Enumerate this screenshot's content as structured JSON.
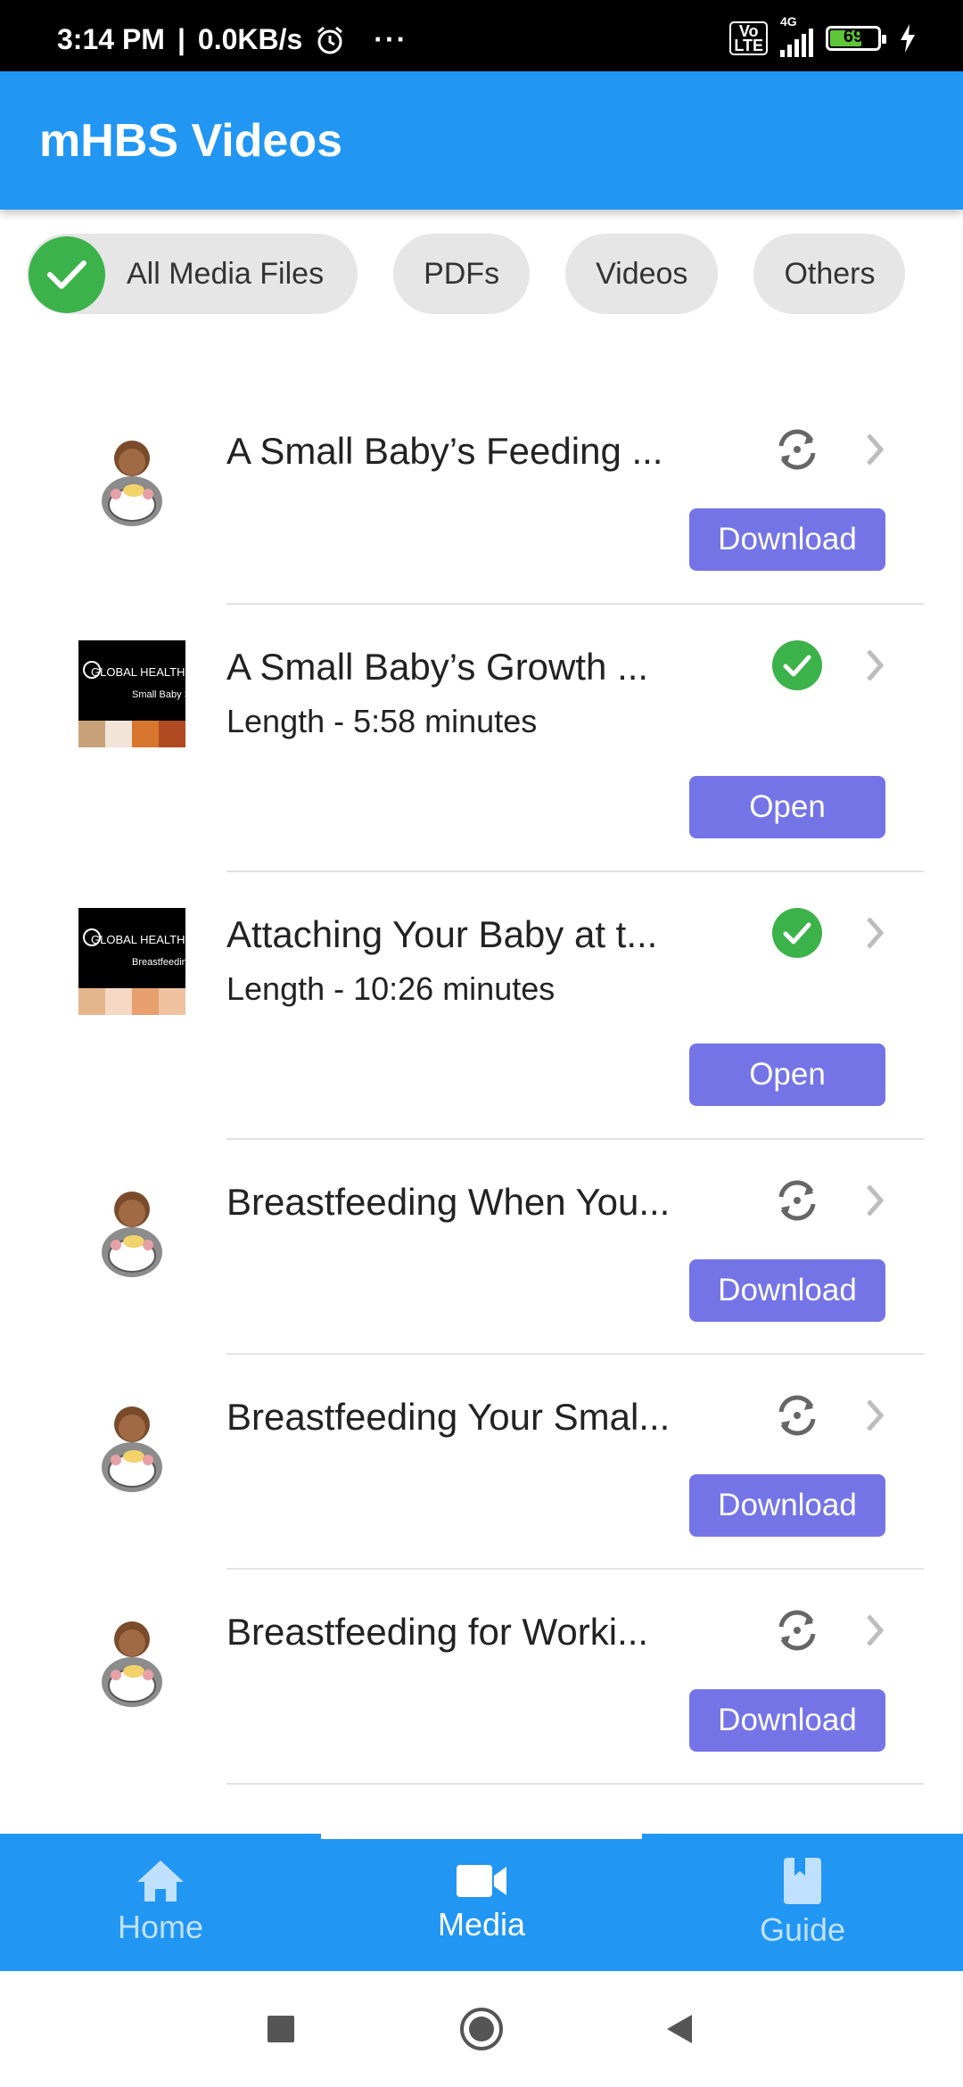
{
  "status_bar": {
    "time": "3:14 PM",
    "speed": "0.0KB/s",
    "more": "···",
    "network": "4G",
    "volte": "Vo LTE",
    "battery": "69"
  },
  "app": {
    "title": "mHBS Videos"
  },
  "filters": {
    "selected": "All Media Files",
    "chips": [
      "All Media Files",
      "PDFs",
      "Videos",
      "Others"
    ]
  },
  "media_items": [
    {
      "title": "A Small Baby’s Feeding ...",
      "length": "",
      "status": "not-downloaded",
      "action": "Download",
      "thumbnail": "mother-baby-icon"
    },
    {
      "title": "A Small Baby’s Growth ...",
      "length": "Length - 5:58 minutes",
      "status": "downloaded",
      "action": "Open",
      "thumbnail": "video-poster-icon"
    },
    {
      "title": "Attaching Your Baby at t...",
      "length": "Length - 10:26 minutes",
      "status": "downloaded",
      "action": "Open",
      "thumbnail": "video-poster-icon"
    },
    {
      "title": "Breastfeeding When You...",
      "length": "",
      "status": "not-downloaded",
      "action": "Download",
      "thumbnail": "mother-baby-icon"
    },
    {
      "title": "Breastfeeding Your Smal...",
      "length": "",
      "status": "not-downloaded",
      "action": "Download",
      "thumbnail": "mother-baby-icon"
    },
    {
      "title": "Breastfeeding for Worki...",
      "length": "",
      "status": "not-downloaded",
      "action": "Download",
      "thumbnail": "mother-baby-icon"
    }
  ],
  "posters": [
    {
      "line1": "GLOBAL HEALTH MED",
      "line2": "Small Baby Ser"
    },
    {
      "line1": "GLOBAL HEALTH MED",
      "line2": "Breastfeeding Se"
    }
  ],
  "bottom_nav": {
    "active": "Media",
    "items": [
      {
        "label": "Home",
        "icon": "home-icon"
      },
      {
        "label": "Media",
        "icon": "video-camera-icon"
      },
      {
        "label": "Guide",
        "icon": "book-icon"
      }
    ]
  },
  "colors": {
    "primary": "#2196f3",
    "button": "#7474e6",
    "success": "#3cb24a",
    "chip": "#e6e6e6"
  }
}
